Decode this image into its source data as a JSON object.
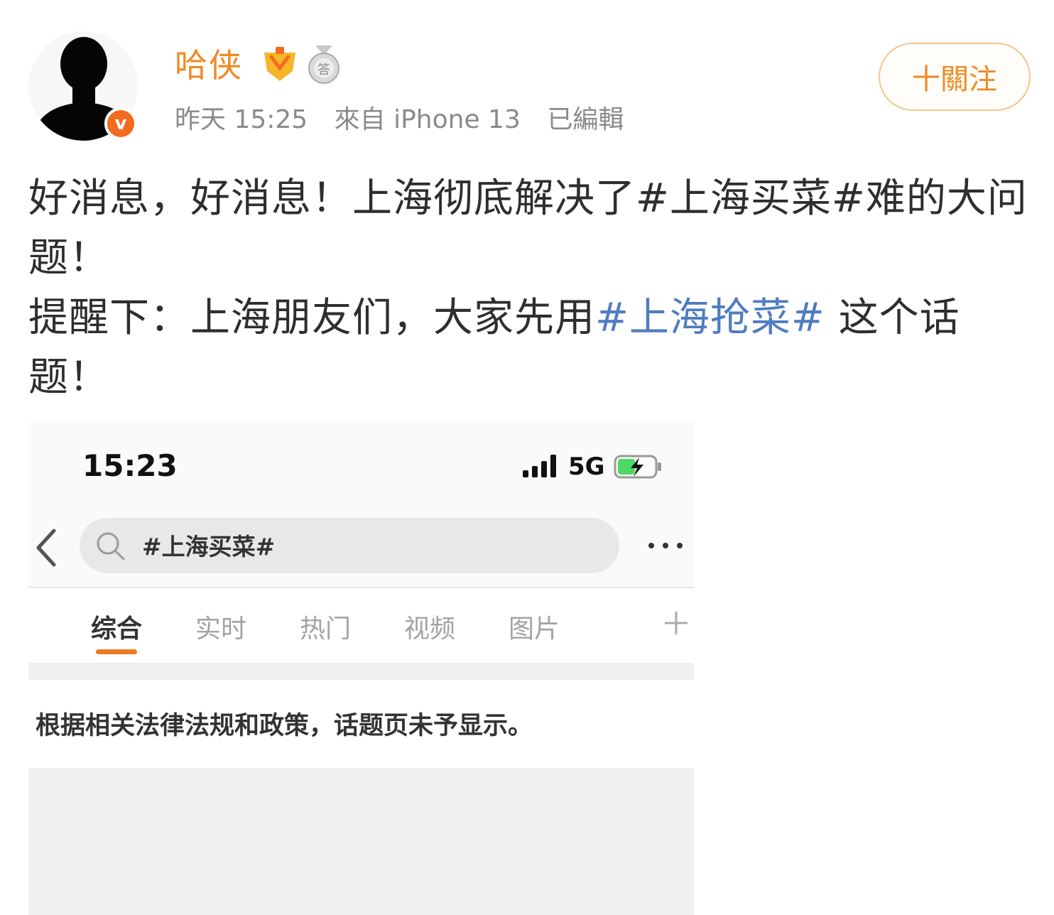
{
  "post": {
    "username": "哈侠",
    "timestamp": "昨天 15:25",
    "source": "來自 iPhone 13",
    "edited": "已編輯",
    "follow_label": "十關注",
    "text_line1": "好消息，好消息！上海彻底解决了#上海买菜#难的大问题！",
    "text_line2_prefix": "提醒下：上海朋友们，大家先用",
    "text_line2_topic": "#上海抢菜#",
    "text_line2_suffix": " 这个话题！",
    "colors": {
      "username": "#f08a24",
      "topic": "#4f7cc0",
      "verified": "#f26b1f"
    },
    "icons": [
      "avatar-silhouette",
      "verified-v-icon",
      "level-badge-icon",
      "medal-icon"
    ]
  },
  "screenshot": {
    "status": {
      "time": "15:23",
      "network": "5G"
    },
    "search": {
      "query": "#上海买菜#"
    },
    "tabs": [
      "综合",
      "实时",
      "热门",
      "视频",
      "图片"
    ],
    "active_tab": "综合",
    "notice": "根据相关法律法规和政策，话题页未予显示。",
    "colors": {
      "tab_underline": "#f07a22"
    },
    "icons": [
      "signal-icon",
      "battery-charging-icon",
      "back-icon",
      "search-icon",
      "more-icon",
      "plus-icon"
    ]
  }
}
